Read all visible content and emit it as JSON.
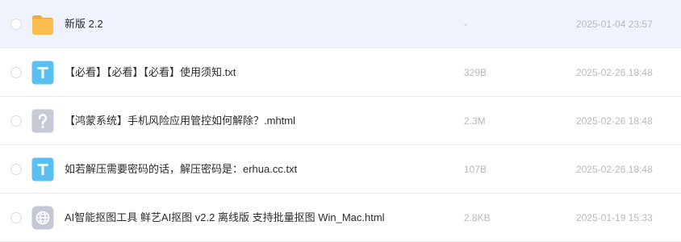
{
  "files": [
    {
      "name": "新版 2.2",
      "size": "-",
      "date": "2025-01-04 23:57",
      "icon": "folder-icon",
      "highlighted": true
    },
    {
      "name": "【必看】【必看】【必看】使用须知.txt",
      "size": "329B",
      "date": "2025-02-26 18:48",
      "icon": "txt-file-icon",
      "highlighted": false
    },
    {
      "name": "【鸿蒙系统】手机风险应用管控如何解除？.mhtml",
      "size": "2.3M",
      "date": "2025-02-26 18:48",
      "icon": "unknown-file-icon",
      "highlighted": false
    },
    {
      "name": "如若解压需要密码的话，解压密码是：erhua.cc.txt",
      "size": "107B",
      "date": "2025-02-26 18:48",
      "icon": "txt-file-icon",
      "highlighted": false
    },
    {
      "name": "AI智能抠图工具 鲜艺AI抠图 v2.2 离线版 支持批量抠图 Win_Mac.html",
      "size": "2.8KB",
      "date": "2025-01-19 15:33",
      "icon": "html-file-icon",
      "highlighted": false
    }
  ],
  "colors": {
    "row_highlight": "#eef3fe",
    "folder": "#fbbd4e",
    "txt_icon": "#5ac0f2",
    "unknown_icon": "#c5cad6",
    "html_icon": "#c3c8d4",
    "name_text": "#2b2b2b",
    "meta_text": "#b8b8b8"
  }
}
